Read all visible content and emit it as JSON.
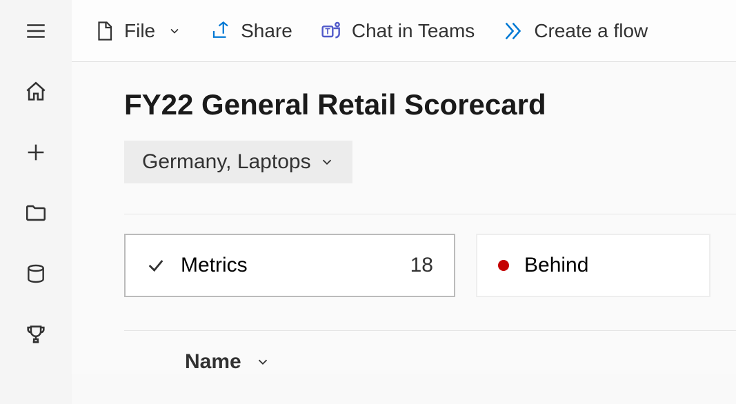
{
  "toolbar": {
    "file_label": "File",
    "share_label": "Share",
    "chat_label": "Chat in Teams",
    "flow_label": "Create a flow"
  },
  "page": {
    "title": "FY22 General Retail Scorecard",
    "filter_label": "Germany, Laptops"
  },
  "cards": {
    "metrics_label": "Metrics",
    "metrics_count": "18",
    "behind_label": "Behind"
  },
  "table": {
    "col_name": "Name"
  }
}
